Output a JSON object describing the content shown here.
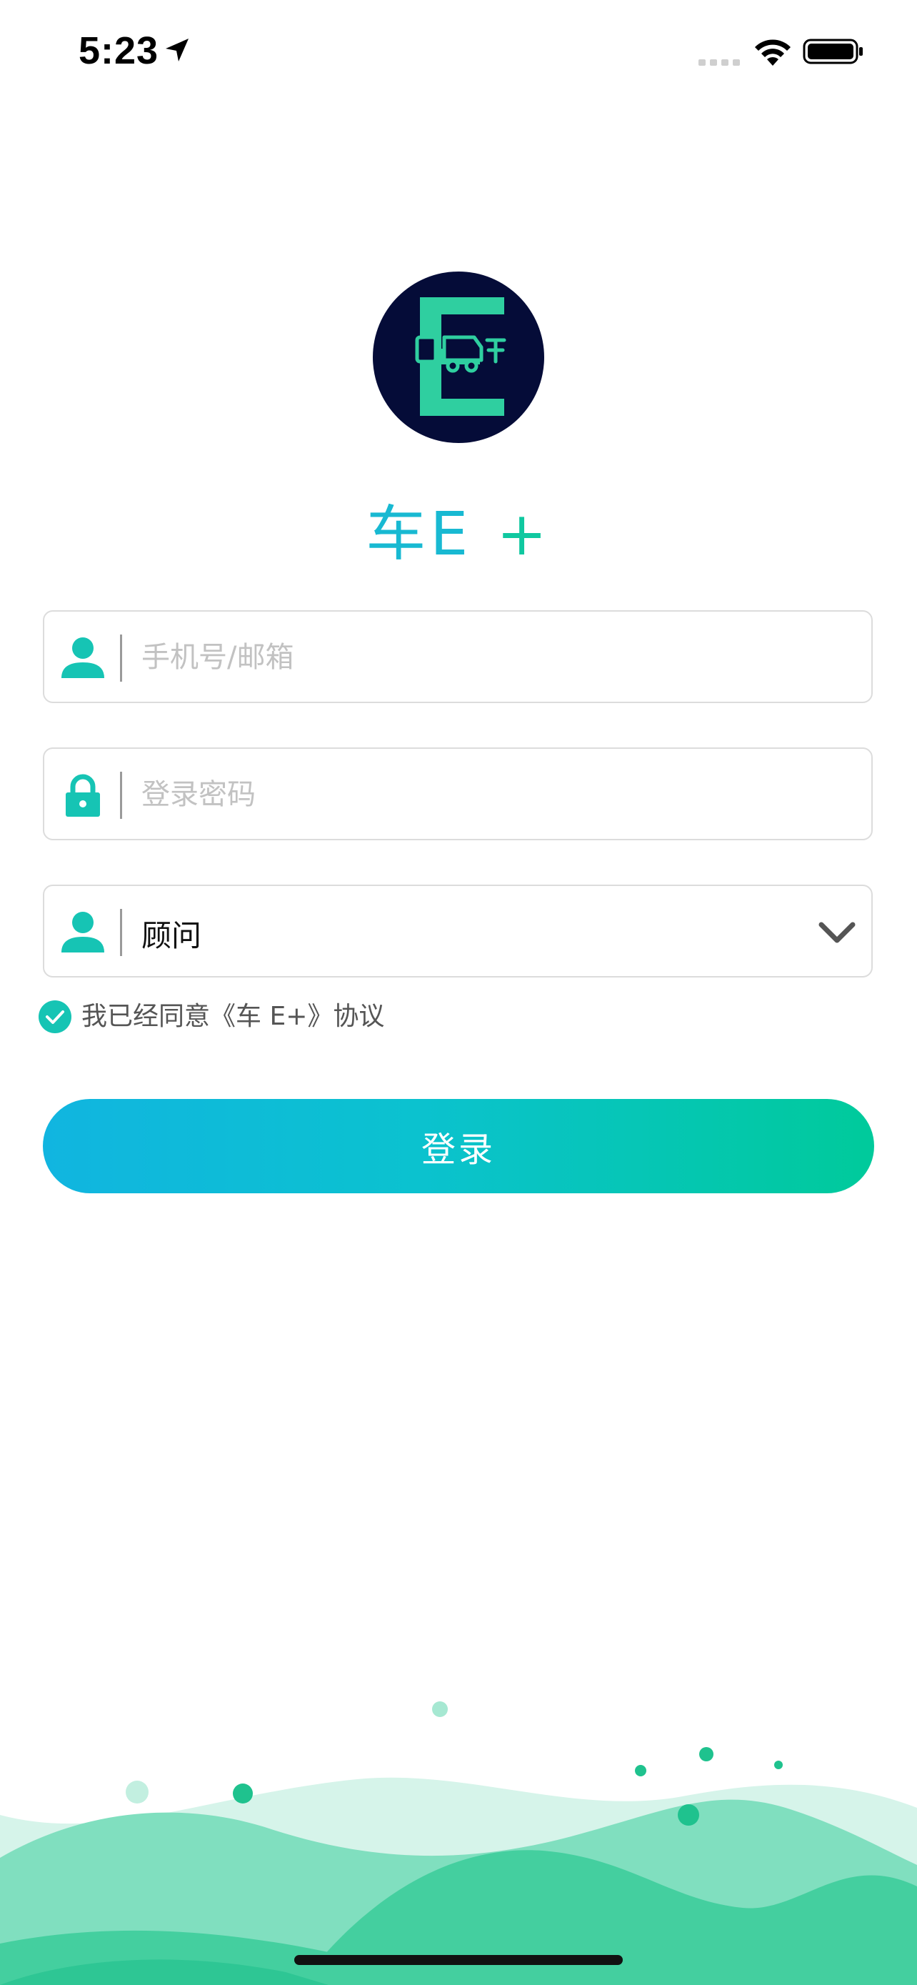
{
  "status_bar": {
    "time": "5:23"
  },
  "app": {
    "name": "车E",
    "plus": "+"
  },
  "form": {
    "account_placeholder": "手机号/邮箱",
    "password_placeholder": "登录密码",
    "role_value": "顾问",
    "agreement_text": "我已经同意《车 E+》协议",
    "login_label": "登录"
  },
  "colors": {
    "primary": "#18b9d2",
    "accent": "#10c8a0",
    "button_gradient_start": "#11b5e0",
    "button_gradient_end": "#00ca9b"
  },
  "icons": {
    "status": [
      "location-arrow-icon",
      "signal-icon",
      "wifi-icon",
      "battery-icon"
    ],
    "form": [
      "user-icon",
      "lock-icon",
      "user-icon",
      "chevron-down-icon",
      "check-icon"
    ]
  }
}
